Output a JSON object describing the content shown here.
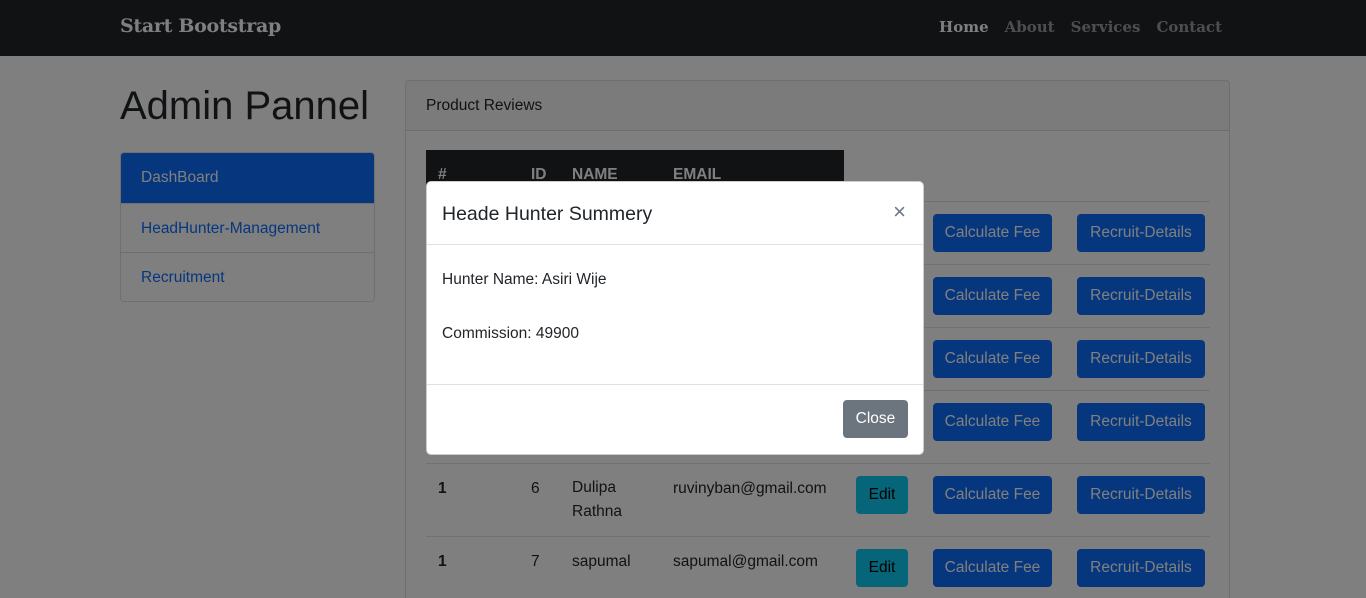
{
  "navbar": {
    "brand": "Start Bootstrap",
    "links": [
      "Home",
      "About",
      "Services",
      "Contact"
    ]
  },
  "page_title": "Admin Pannel",
  "sidebar": {
    "items": [
      {
        "label": "DashBoard",
        "active": true
      },
      {
        "label": "HeadHunter-Management",
        "active": false
      },
      {
        "label": "Recruitment",
        "active": false
      }
    ]
  },
  "card": {
    "header": "Product Reviews",
    "columns": [
      "#",
      "ID",
      "NAME",
      "EMAIL"
    ],
    "rows": [
      {
        "num": "1",
        "id": "6",
        "name": "Dulipa\nRathna",
        "email": "ruvinyban@gmail.com"
      },
      {
        "num": "1",
        "id": "7",
        "name": "sapumal",
        "email": "sapumal@gmail.com"
      }
    ],
    "btn_edit": "Edit",
    "btn_calc": "Calculate Fee",
    "btn_recruit": "Recruit-Details"
  },
  "modal": {
    "title": "Heade Hunter Summery",
    "close_glyph": "×",
    "hunter_name_line": "Hunter Name: Asiri Wije",
    "commission_line": "Commission: 49900",
    "close_button": "Close"
  },
  "colors": {
    "primary": "#0d6efd",
    "info": "#0dcaf0",
    "secondary": "#6c757d",
    "dark": "#212529"
  }
}
